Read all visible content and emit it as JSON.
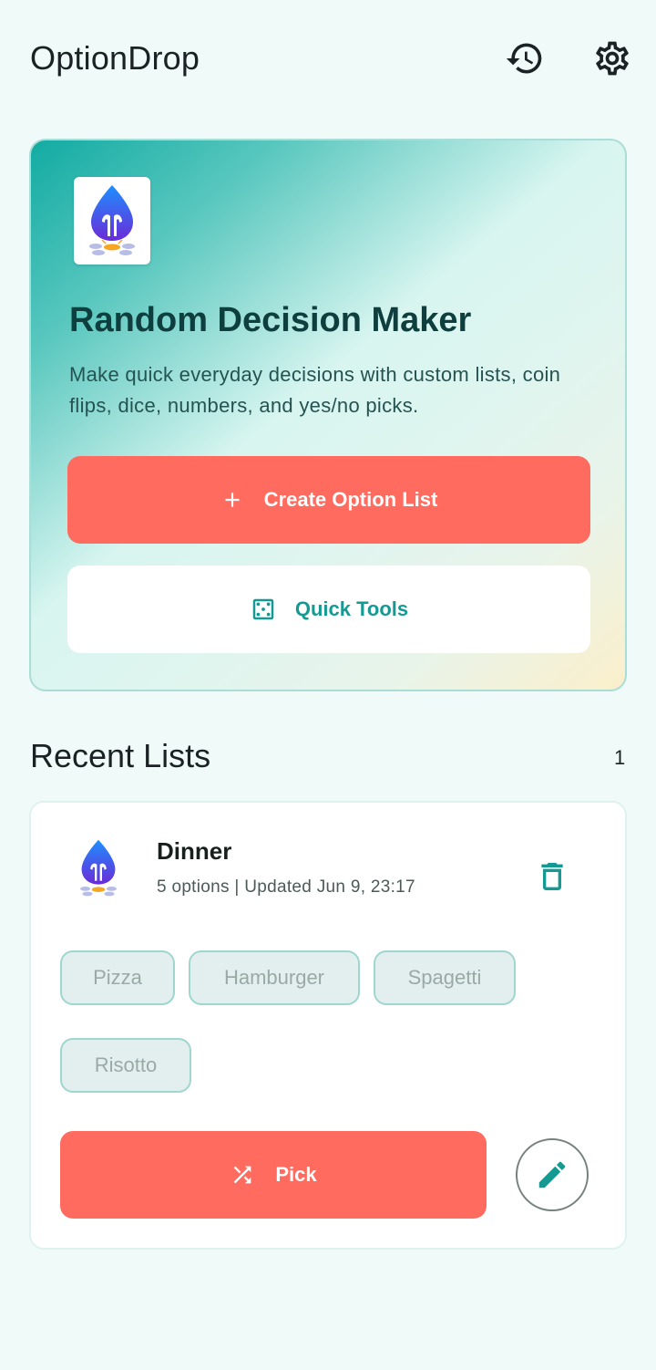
{
  "app": {
    "title": "OptionDrop"
  },
  "header": {
    "history_icon": "history-icon",
    "settings_icon": "gear-icon"
  },
  "hero": {
    "title": "Random Decision Maker",
    "description": "Make quick everyday decisions with custom lists, coin flips, dice, numbers, and yes/no picks.",
    "create_label": "Create Option List",
    "quick_tools_label": "Quick Tools",
    "accent": "#12aba3",
    "primary_button_color": "#ff6b5e"
  },
  "recent": {
    "title": "Recent Lists",
    "count": "1",
    "lists": [
      {
        "name": "Dinner",
        "meta": "5 options | Updated Jun 9, 23:17",
        "options": [
          "Pizza",
          "Hamburger",
          "Spagetti",
          "Risotto"
        ],
        "pick_label": "Pick"
      }
    ]
  }
}
